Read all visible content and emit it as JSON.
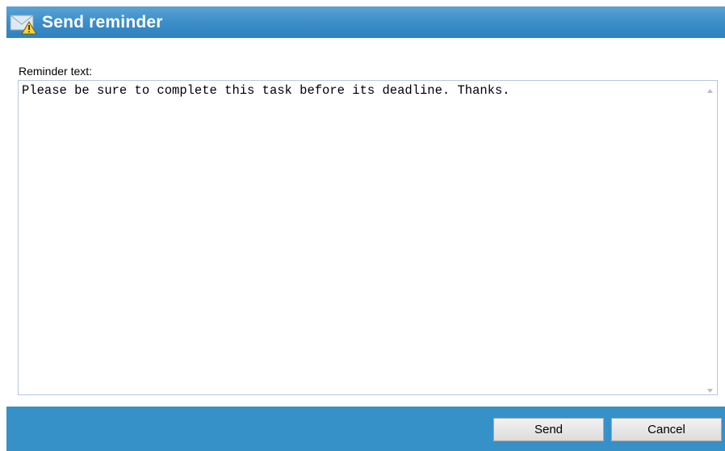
{
  "dialog": {
    "title": "Send reminder",
    "title_icon": "envelope-warning-icon",
    "accent_color": "#3591c8"
  },
  "form": {
    "label": "Reminder text:",
    "value": "Please be sure to complete this task before its deadline. Thanks."
  },
  "footer": {
    "send_label": "Send",
    "cancel_label": "Cancel"
  }
}
